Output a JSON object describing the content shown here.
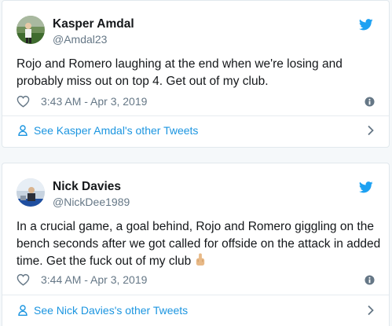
{
  "colors": {
    "twitter_blue": "#1da1f2",
    "link_blue": "#1b95e0",
    "text": "#14171a",
    "secondary": "#657786",
    "emoji_skin": "#e8b987"
  },
  "tweets": [
    {
      "display_name": "Kasper Amdal",
      "handle": "@Amdal23",
      "text": "Rojo and Romero laughing at the end when we're losing and probably miss out on top 4. Get out of my club.",
      "timestamp": "3:43 AM - Apr 3, 2019",
      "more_link": "See Kasper Amdal's other Tweets",
      "icons": [
        "avatar",
        "twitter-logo-icon",
        "heart-icon",
        "info-icon",
        "person-icon",
        "chevron-right-icon"
      ]
    },
    {
      "display_name": "Nick Davies",
      "handle": "@NickDee1989",
      "text": "In a crucial game, a goal behind, Rojo and Romero giggling on the bench seconds after we got called for offside on the attack in added time. Get the fuck out of my club",
      "emoji": "middle-finger-emoji",
      "timestamp": "3:44 AM - Apr 3, 2019",
      "more_link": "See Nick Davies's other Tweets",
      "icons": [
        "avatar",
        "twitter-logo-icon",
        "heart-icon",
        "info-icon",
        "person-icon",
        "chevron-right-icon"
      ]
    }
  ]
}
